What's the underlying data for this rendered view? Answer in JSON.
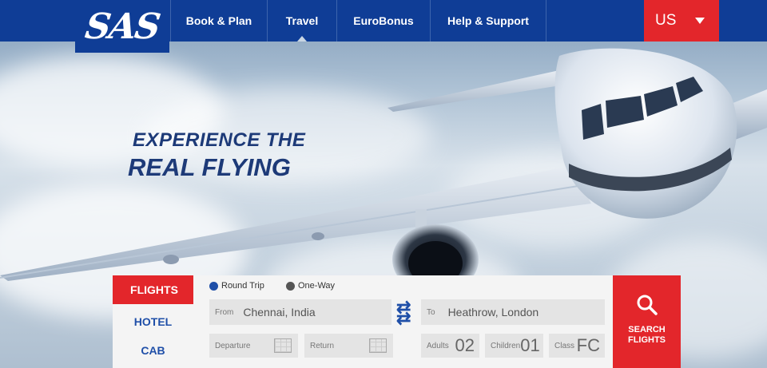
{
  "brand": {
    "logo": "SAS"
  },
  "nav": {
    "items": [
      {
        "label": "Book & Plan"
      },
      {
        "label": "Travel"
      },
      {
        "label": "EuroBonus"
      },
      {
        "label": "Help & Support"
      }
    ],
    "locale": "US"
  },
  "hero": {
    "line1": "EXPERIENCE THE",
    "line2": "REAL FLYING"
  },
  "booking": {
    "tabs": [
      "FLIGHTS",
      "HOTEL",
      "CAB"
    ],
    "trip_options": [
      "Round Trip",
      "One-Way"
    ],
    "from_label": "From",
    "from_value": "Chennai, India",
    "to_label": "To",
    "to_value": "Heathrow, London",
    "departure_label": "Departure",
    "return_label": "Return",
    "adults_label": "Adults",
    "adults_value": "02",
    "children_label": "Children",
    "children_value": "01",
    "class_label": "Class",
    "class_value": "FC",
    "search_line1": "SEARCH",
    "search_line2": "FLIGHTS"
  },
  "colors": {
    "brand_blue": "#0f3d96",
    "accent_red": "#e3262b"
  }
}
